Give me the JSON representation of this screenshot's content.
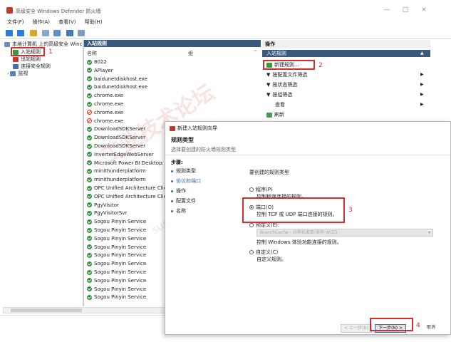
{
  "window": {
    "title": "高级安全 Windows Defender 防火墙",
    "minimize": "—",
    "maximize": "□",
    "close": "×"
  },
  "menu": [
    "文件(F)",
    "操作(A)",
    "查看(V)",
    "帮助(H)"
  ],
  "tree": {
    "root": "本地计算机 上的高级安全 Winc",
    "items": [
      "入站规则",
      "出站规则",
      "连接安全规则",
      "监视"
    ]
  },
  "list": {
    "header": "入站规则",
    "col_name": "名称",
    "col_group": "组",
    "rows": [
      {
        "name": "8022",
        "status": "ok"
      },
      {
        "name": "APlayer",
        "status": "ok"
      },
      {
        "name": "baidunetdiskhost.exe",
        "status": "ok"
      },
      {
        "name": "baidunetdiskhost.exe",
        "status": "ok"
      },
      {
        "name": "chrome.exe",
        "status": "ok"
      },
      {
        "name": "chrome.exe",
        "status": "ok"
      },
      {
        "name": "chrome.exe",
        "status": "block"
      },
      {
        "name": "chrome.exe",
        "status": "block"
      },
      {
        "name": "DownloadSDKServer",
        "status": "ok"
      },
      {
        "name": "DownloadSDKServer",
        "status": "ok"
      },
      {
        "name": "DownloadSDKServer",
        "status": "ok"
      },
      {
        "name": "InverterEdgeWebServer",
        "status": "ok"
      },
      {
        "name": "Microsoft Power BI Desktop: Analy",
        "status": "ok"
      },
      {
        "name": "minithunderplatform",
        "status": "ok"
      },
      {
        "name": "minithunderplatform",
        "status": "ok"
      },
      {
        "name": "OPC Unified Architecture Client",
        "status": "ok"
      },
      {
        "name": "OPC Unified Architecture Client",
        "status": "ok"
      },
      {
        "name": "PgyVisitor",
        "status": "ok"
      },
      {
        "name": "PgyVisitorSvr",
        "status": "ok"
      },
      {
        "name": "Sogou Pinyin Service",
        "status": "ok"
      },
      {
        "name": "Sogou Pinyin Service",
        "status": "ok"
      },
      {
        "name": "Sogou Pinyin Service",
        "status": "ok"
      },
      {
        "name": "Sogou Pinyin Service",
        "status": "ok"
      },
      {
        "name": "Sogou Pinyin Service",
        "status": "ok"
      },
      {
        "name": "Sogou Pinyin Service",
        "status": "ok"
      },
      {
        "name": "Sogou Pinyin Service",
        "status": "ok"
      },
      {
        "name": "Sogou Pinyin Service",
        "status": "ok"
      },
      {
        "name": "Sogou Pinyin Service",
        "status": "ok"
      },
      {
        "name": "Sogou Pinyin Service",
        "status": "ok"
      }
    ]
  },
  "actions": {
    "header": "操作",
    "section": "入站规则",
    "items": [
      "新建规则...",
      "按配置文件筛选",
      "按状态筛选",
      "按组筛选",
      "查看",
      "刷新"
    ]
  },
  "wizard": {
    "title": "新建入站规则向导",
    "heading": "规则类型",
    "desc": "选择要创建的防火墙规则类型",
    "steps_header": "步骤:",
    "steps": [
      "规则类型",
      "协议和端口",
      "操作",
      "配置文件",
      "名称"
    ],
    "prompt": "要创建的规则类型",
    "options": [
      {
        "label": "程序(P)",
        "desc": "控制程序连接的规则。"
      },
      {
        "label": "端口(O)",
        "desc": "控制 TCP 或 UDP 端口连接的规则。"
      },
      {
        "label": "预定义(E):",
        "desc": ""
      },
      {
        "label": "自定义(C)",
        "desc": "自定义规则。"
      }
    ],
    "predefined_value": "BranchCache - 对等机发现(使用 WSD)",
    "predefined_desc": "控制 Windows 体验功能连接的规则。",
    "buttons": {
      "back": "< 上一步(B)",
      "next": "下一步(N) >",
      "cancel": "取消"
    }
  },
  "annotations": [
    "1",
    "2",
    "3",
    "4"
  ],
  "watermark": "工业技术论坛",
  "watermark2": "support.industry.siemens.com/cs",
  "colors": {
    "header_blue": "#3a5a7d",
    "annotation_red": "#d32f2f",
    "ok_green": "#2f8f3a"
  }
}
